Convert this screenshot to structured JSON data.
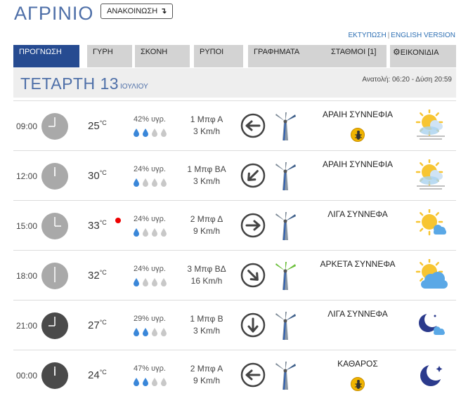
{
  "header": {
    "city": "ΑΓΡΙΝΙΟ",
    "announce_label": "ΑΝΑΚΟΙΝΩΣΗ",
    "announce_arrow": "↴",
    "print_link": "ΕΚΤΥΠΩΣΗ",
    "link_separator": "|",
    "english_link": "ENGLISH VERSION"
  },
  "tabs": [
    {
      "label": "ΠΡΟΓΝΩΣΗ",
      "active": true
    },
    {
      "label": "ΓΥΡΗ",
      "active": false
    },
    {
      "label": "ΣΚΟΝΗ",
      "active": false
    },
    {
      "label": "ΡΥΠΟΙ",
      "active": false
    },
    {
      "label": "ΓΡΑΦΗΜΑΤΑ",
      "active": false
    },
    {
      "label": "ΣΤΑΘΜΟΙ [1]",
      "active": false
    },
    {
      "label": "ΕΙΚΟΝΙΔΙΑ",
      "active": false,
      "icon": "gear-icon"
    }
  ],
  "day": {
    "name": "ΤΕΤΑΡΤΗ 13",
    "month": "ΙΟΥΛΙΟΥ",
    "sun": "Ανατολή: 06:20  - Δύση 20:59"
  },
  "temp_unit": "°C",
  "colors": {
    "accent": "#264b91",
    "title_blue": "#4e6fa8",
    "drop_blue": "#3a87d9",
    "drop_grey": "#c8c8c8",
    "hot_dot": "#e00000"
  },
  "rows": [
    {
      "time": "09:00",
      "clock_hour": 9,
      "night": false,
      "temp": "25",
      "hot": false,
      "humidity": "42% υγρ.",
      "humidity_level": 2,
      "wind_force": "1 Μπφ Α",
      "wind_speed": "3 Km/h",
      "wind_arrow": "west",
      "turbine_color": "grey",
      "condition": "ΑΡΑΙΗ ΣΥΝΝΕΦΙΑ",
      "badge": true,
      "weather_icon": "few-clouds-haze-icon"
    },
    {
      "time": "12:00",
      "clock_hour": 12,
      "night": false,
      "temp": "30",
      "hot": false,
      "humidity": "24% υγρ.",
      "humidity_level": 1,
      "wind_force": "1 Μπφ ΒΑ",
      "wind_speed": "3 Km/h",
      "wind_arrow": "south-west",
      "turbine_color": "grey",
      "condition": "ΑΡΑΙΗ ΣΥΝΝΕΦΙΑ",
      "badge": false,
      "weather_icon": "few-clouds-haze-icon"
    },
    {
      "time": "15:00",
      "clock_hour": 3,
      "night": false,
      "temp": "33",
      "hot": true,
      "humidity": "24% υγρ.",
      "humidity_level": 1,
      "wind_force": "2 Μπφ Δ",
      "wind_speed": "9 Km/h",
      "wind_arrow": "east",
      "turbine_color": "grey",
      "condition": "ΛΙΓΑ ΣΥΝΝΕΦΑ",
      "badge": false,
      "weather_icon": "sun-small-cloud-icon"
    },
    {
      "time": "18:00",
      "clock_hour": 6,
      "night": false,
      "temp": "32",
      "hot": false,
      "humidity": "24% υγρ.",
      "humidity_level": 1,
      "wind_force": "3 Μπφ ΒΔ",
      "wind_speed": "16 Km/h",
      "wind_arrow": "south-east",
      "turbine_color": "green",
      "condition": "ΑΡΚΕΤΑ ΣΥΝΝΕΦΑ",
      "badge": false,
      "weather_icon": "sun-big-cloud-icon"
    },
    {
      "time": "21:00",
      "clock_hour": 9,
      "night": true,
      "temp": "27",
      "hot": false,
      "humidity": "29% υγρ.",
      "humidity_level": 2,
      "wind_force": "1 Μπφ Β",
      "wind_speed": "3 Km/h",
      "wind_arrow": "south",
      "turbine_color": "grey",
      "condition": "ΛΙΓΑ ΣΥΝΝΕΦΑ",
      "badge": false,
      "weather_icon": "moon-cloud-icon"
    },
    {
      "time": "00:00",
      "clock_hour": 12,
      "night": true,
      "temp": "24",
      "hot": false,
      "humidity": "47% υγρ.",
      "humidity_level": 2,
      "wind_force": "2 Μπφ Α",
      "wind_speed": "9 Km/h",
      "wind_arrow": "west",
      "turbine_color": "grey",
      "condition": "ΚΑΘΑΡΟΣ",
      "badge": true,
      "weather_icon": "moon-clear-icon"
    }
  ]
}
